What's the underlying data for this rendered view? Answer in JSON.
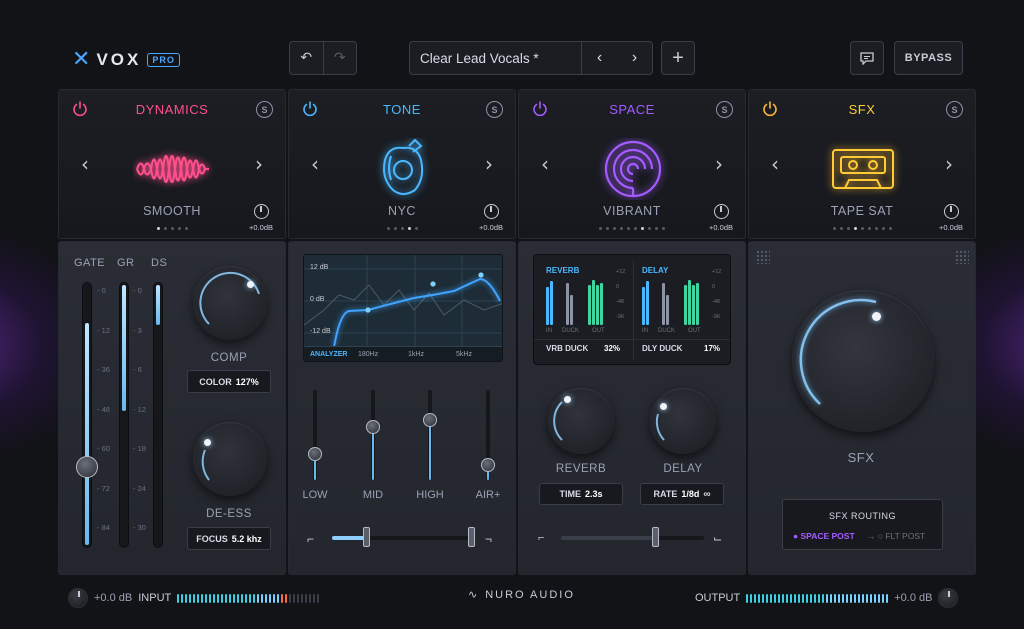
{
  "header": {
    "logo_name": "VOX",
    "logo_badge": "PRO",
    "preset_name": "Clear Lead Vocals *",
    "bypass_label": "BYPASS"
  },
  "modules": [
    {
      "title": "DYNAMICS",
      "color": "#ff4f8b",
      "preset": "SMOOTH",
      "gain": "+0.0dB"
    },
    {
      "title": "TONE",
      "color": "#4ab8ff",
      "preset": "NYC",
      "gain": "+0.0dB"
    },
    {
      "title": "SPACE",
      "color": "#a45bff",
      "preset": "VIBRANT",
      "gain": "+0.0dB"
    },
    {
      "title": "SFX",
      "color": "#ffcc33",
      "preset": "TAPE SAT",
      "gain": "+0.0dB"
    }
  ],
  "dynamics": {
    "meter_labels": [
      "GATE",
      "GR",
      "DS"
    ],
    "gate_scale": [
      "0",
      "12",
      "36",
      "48",
      "60",
      "72",
      "84"
    ],
    "gr_scale": [
      "0",
      "3",
      "6",
      "12",
      "18",
      "24",
      "30"
    ],
    "gate_level": 0.6,
    "comp_label": "COMP",
    "color_label": "COLOR",
    "color_value": "127%",
    "deess_label": "DE-ESS",
    "focus_label": "FOCUS",
    "focus_value": "5.2 khz"
  },
  "tone": {
    "db_labels": [
      "12 dB",
      "0 dB",
      "-12 dB"
    ],
    "analyzer_label": "ANALYZER",
    "freq_labels": [
      "180Hz",
      "1kHz",
      "5kHz"
    ],
    "bands": [
      "LOW",
      "MID",
      "HIGH",
      "AIR+"
    ],
    "band_levels": [
      0.25,
      0.6,
      0.7,
      0.1
    ]
  },
  "space": {
    "reverb_title": "REVERB",
    "delay_title": "DELAY",
    "meter_scale": [
      "+12",
      "0",
      "-48",
      "-96"
    ],
    "meter_labels": [
      "IN",
      "DUCK",
      "OUT"
    ],
    "vrb_duck_label": "VRB DUCK",
    "vrb_duck_value": "32%",
    "dly_duck_label": "DLY DUCK",
    "dly_duck_value": "17%",
    "reverb_label": "REVERB",
    "delay_label": "DELAY",
    "time_label": "TIME",
    "time_value": "2.3s",
    "rate_label": "RATE",
    "rate_value": "1/8d"
  },
  "sfx": {
    "knob_label": "SFX",
    "routing_title": "SFX ROUTING",
    "routing_active": "SPACE POST",
    "routing_inactive": "FLT POST"
  },
  "footer": {
    "input_gain": "+0.0 dB",
    "input_label": "INPUT",
    "brand": "NURO AUDIO",
    "output_label": "OUTPUT",
    "output_gain": "+0.0 dB"
  }
}
